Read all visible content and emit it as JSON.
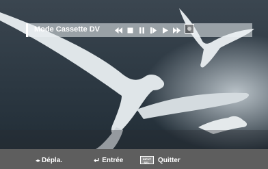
{
  "osd": {
    "title": "Mode Cassette DV",
    "controls": [
      "rewind-icon",
      "stop-icon",
      "pause-icon",
      "step-icon",
      "play-icon",
      "fast-forward-icon",
      "record-icon"
    ]
  },
  "footer": {
    "move_label": "Dépla.",
    "enter_label": "Entrée",
    "exit_key_top": "INPUT",
    "exit_key_bottom": "SEL.",
    "exit_label": "Quitter"
  },
  "colors": {
    "osd_bar": "#e6eaed",
    "footer_bg": "#5e5e5e",
    "text": "#ffffff"
  }
}
